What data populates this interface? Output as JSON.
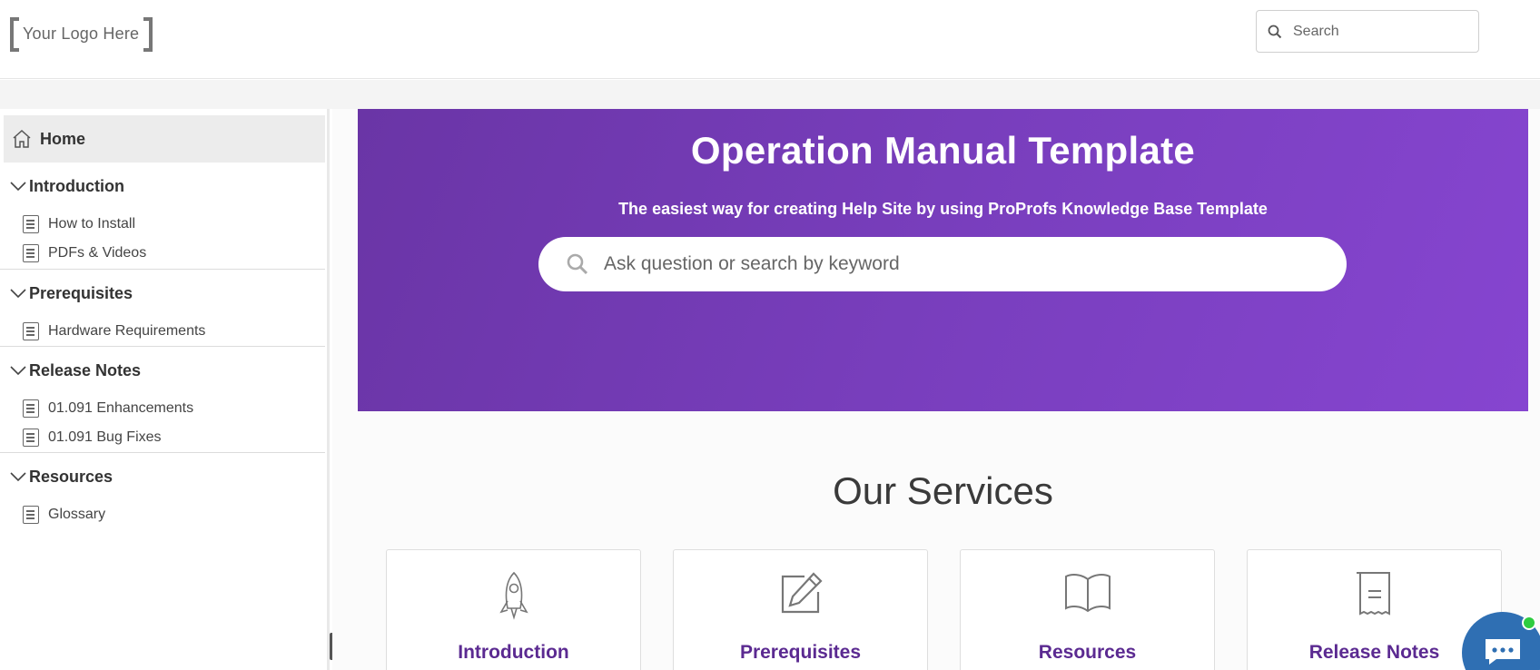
{
  "header": {
    "logo_text": "Your Logo Here",
    "search_placeholder": "Search"
  },
  "sidebar": {
    "home_label": "Home",
    "sections": [
      {
        "title": "Introduction",
        "items": [
          "How to Install",
          "PDFs & Videos"
        ]
      },
      {
        "title": "Prerequisites",
        "items": [
          "Hardware Requirements"
        ]
      },
      {
        "title": "Release Notes",
        "items": [
          "01.091 Enhancements",
          "01.091 Bug Fixes"
        ]
      },
      {
        "title": "Resources",
        "items": [
          "Glossary"
        ]
      }
    ]
  },
  "hero": {
    "title": "Operation Manual Template",
    "subtitle": "The easiest way for creating Help Site by using ProProfs Knowledge Base Template",
    "search_placeholder": "Ask question or search by keyword"
  },
  "services": {
    "title": "Our Services",
    "cards": [
      {
        "label": "Introduction",
        "icon": "rocket-icon"
      },
      {
        "label": "Prerequisites",
        "icon": "edit-icon"
      },
      {
        "label": "Resources",
        "icon": "book-icon"
      },
      {
        "label": "Release Notes",
        "icon": "receipt-icon"
      }
    ]
  },
  "colors": {
    "hero_gradient_start": "#6a35a6",
    "hero_gradient_end": "#8645d0",
    "card_label": "#5b2a91",
    "chat_bubble": "#2f6fb3"
  }
}
